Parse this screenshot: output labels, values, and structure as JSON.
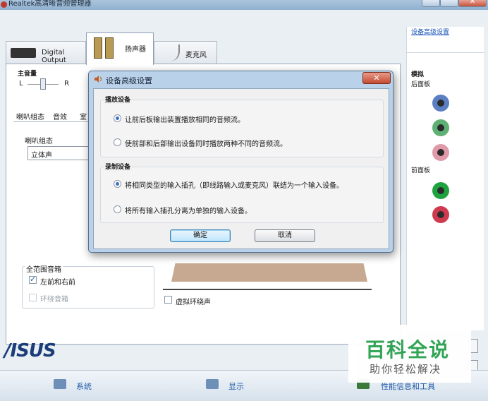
{
  "window": {
    "title": "Realtek高清晰音频管理器"
  },
  "tabs": [
    {
      "label": "Digital Output"
    },
    {
      "label": "扬声器"
    },
    {
      "label": "麦克风"
    }
  ],
  "right_panel": {
    "advanced_link": "设备高级设置",
    "analog_heading": "模拟",
    "back_panel_label": "后面板",
    "front_panel_label": "前面板",
    "back_jacks": [
      "#5b7fc2",
      "#5fb074",
      "#e09aaa"
    ],
    "front_jacks": [
      "#1fa340",
      "#d03a4e"
    ]
  },
  "speaker_panel": {
    "main_volume_label": "主音量",
    "left_label": "L",
    "right_label": "R",
    "subtabs": [
      "喇叭组态",
      "音效",
      "室"
    ],
    "config_label": "喇叭组态",
    "config_value": "立体声",
    "fullrange_label": "全范围音箱",
    "front_lr_label": "左前和右前",
    "surround_label": "环绕音箱",
    "virtual_surround_label": "虚拟环绕声"
  },
  "dialog": {
    "title": "设备高级设置",
    "playback_group": "播放设备",
    "playback_options": [
      {
        "label": "让前后板输出装置播放相同的音频流。",
        "selected": true
      },
      {
        "label": "使前部和后部输出设备同时播放两种不同的音频流。",
        "selected": false
      }
    ],
    "record_group": "录制设备",
    "record_options": [
      {
        "label": "将相同类型的输入插孔（即线路输入或麦克风）联结为一个输入设备。",
        "selected": true
      },
      {
        "label": "将所有输入插孔分离为单独的输入设备。",
        "selected": false
      }
    ],
    "ok_label": "确定",
    "cancel_label": "取消",
    "close_glyph": "✕"
  },
  "brand": {
    "logo_text": "/ISUS"
  },
  "bottom_bar": {
    "items": [
      "系统",
      "显示",
      "性能信息和工具"
    ]
  },
  "watermark": {
    "title": "百科全说",
    "subtitle": "助你轻松解决"
  }
}
